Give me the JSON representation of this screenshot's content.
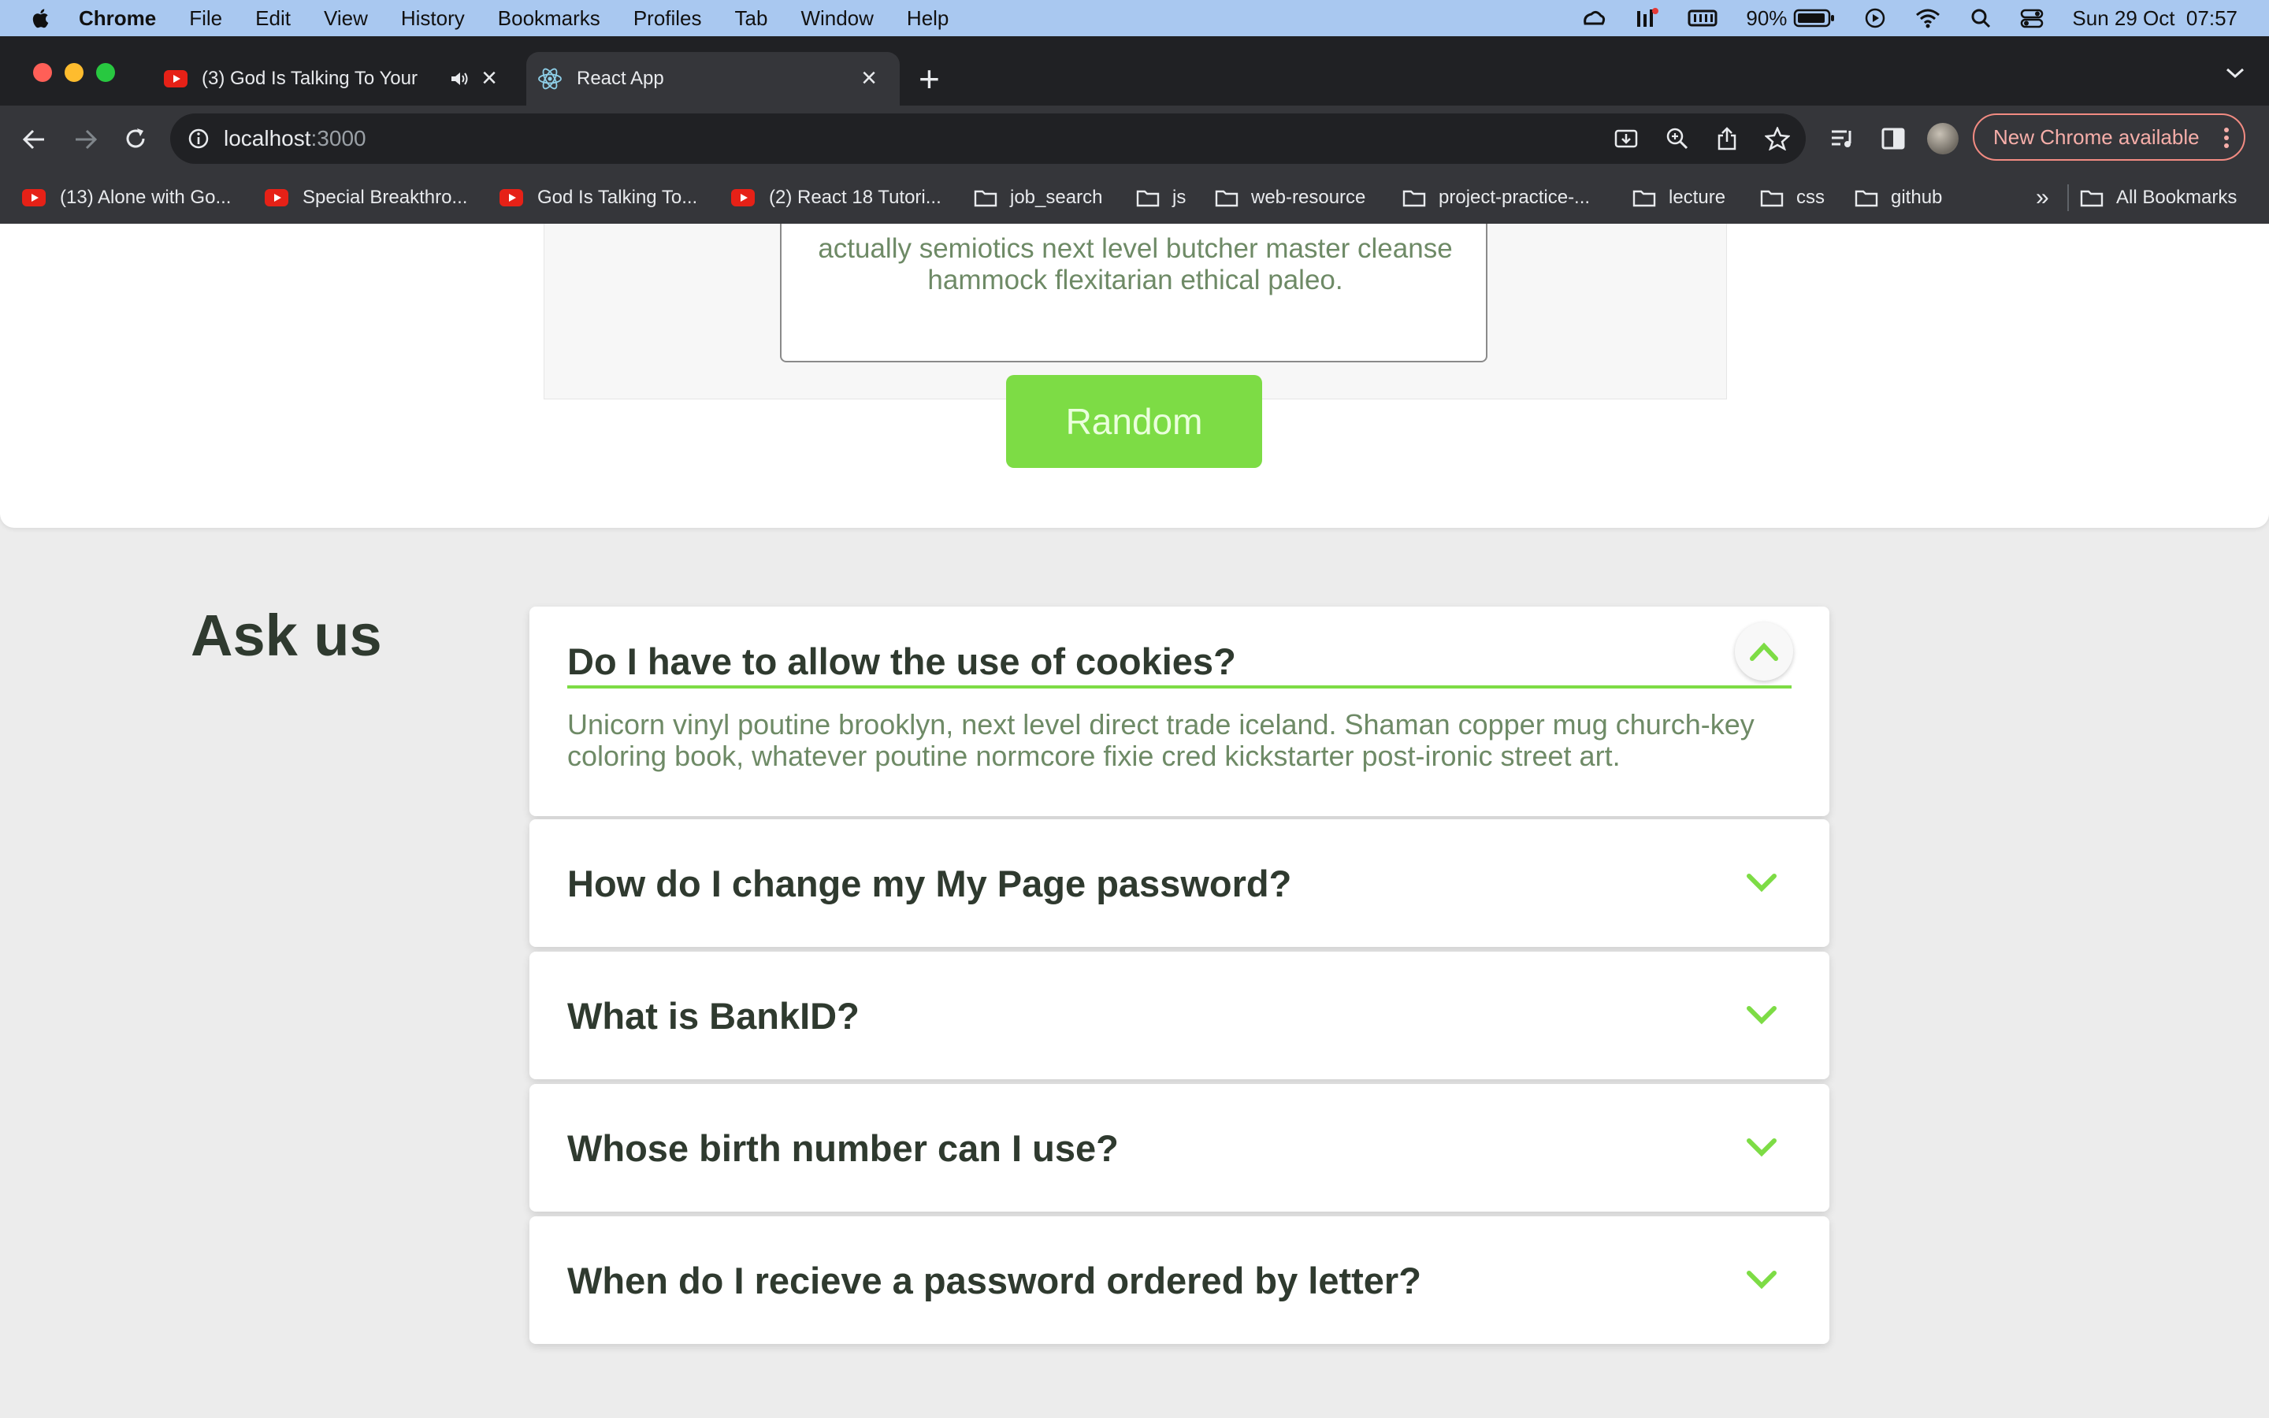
{
  "menubar": {
    "items": [
      "Chrome",
      "File",
      "Edit",
      "View",
      "History",
      "Bookmarks",
      "Profiles",
      "Tab",
      "Window",
      "Help"
    ],
    "battery": "90%",
    "datetime": "Sun 29 Oct  07:57"
  },
  "tabs": [
    {
      "title": "(3) God Is Talking To Your",
      "icon": "youtube-icon",
      "audio": "speaker-icon"
    },
    {
      "title": "React App",
      "icon": "react-icon"
    }
  ],
  "toolbar": {
    "url_host": "localhost",
    "url_port": ":3000",
    "update_label": "New Chrome available"
  },
  "bookmarks": [
    {
      "label": "(13) Alone with Go...",
      "icon": "youtube-icon"
    },
    {
      "label": "Special Breakthro...",
      "icon": "youtube-icon"
    },
    {
      "label": "God Is Talking To...",
      "icon": "youtube-icon"
    },
    {
      "label": "(2) React 18 Tutori...",
      "icon": "youtube-icon"
    },
    {
      "label": "job_search",
      "icon": "folder-icon"
    },
    {
      "label": "js",
      "icon": "folder-icon"
    },
    {
      "label": "web-resource",
      "icon": "folder-icon"
    },
    {
      "label": "project-practice-...",
      "icon": "folder-icon"
    },
    {
      "label": "lecture",
      "icon": "folder-icon"
    },
    {
      "label": "css",
      "icon": "folder-icon"
    },
    {
      "label": "github",
      "icon": "folder-icon"
    }
  ],
  "bookmarks_overflow": "»",
  "all_bookmarks": "All Bookmarks",
  "review": {
    "text": "actually semiotics next level butcher master cleanse hammock flexitarian ethical paleo.",
    "button": "Random"
  },
  "faq": {
    "title": "Ask us",
    "items": [
      {
        "question": "Do I have to allow the use of cookies?",
        "answer": "Unicorn vinyl poutine brooklyn, next level direct trade iceland. Shaman copper mug church-key coloring book, whatever poutine normcore fixie cred kickstarter post-ironic street art.",
        "expanded": true
      },
      {
        "question": "How do I change my My Page password?",
        "expanded": false
      },
      {
        "question": "What is BankID?",
        "expanded": false
      },
      {
        "question": "Whose birth number can I use?",
        "expanded": false
      },
      {
        "question": "When do I recieve a password ordered by letter?",
        "expanded": false
      }
    ]
  },
  "colors": {
    "accent": "#7ddc45",
    "text_dark": "#2f3a2f",
    "text_muted": "#6e8a66"
  }
}
